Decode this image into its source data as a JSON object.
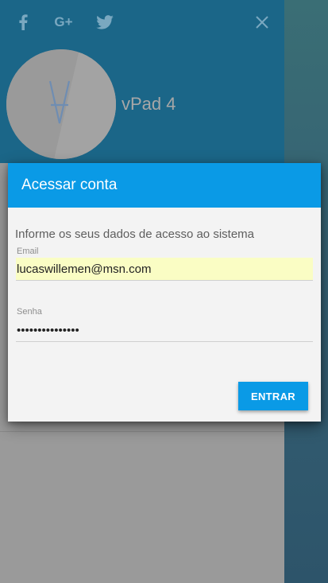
{
  "drawer": {
    "social_icons": [
      "facebook-icon",
      "google-plus-icon",
      "twitter-icon"
    ],
    "google_plus_glyph": "G+",
    "close_icon": "close-icon",
    "app_name": "vPad 4"
  },
  "dialog": {
    "title": "Acessar conta",
    "hint": "Informe os seus dados de acesso ao sistema",
    "email": {
      "label": "Email",
      "value": "lucaswillemen@msn.com"
    },
    "password": {
      "label": "Senha",
      "value": "•••••••••••••••"
    },
    "submit_label": "ENTRAR"
  },
  "colors": {
    "header_blue": "#1b6688",
    "accent": "#0a9ae6",
    "autofill": "#fafdc4"
  }
}
